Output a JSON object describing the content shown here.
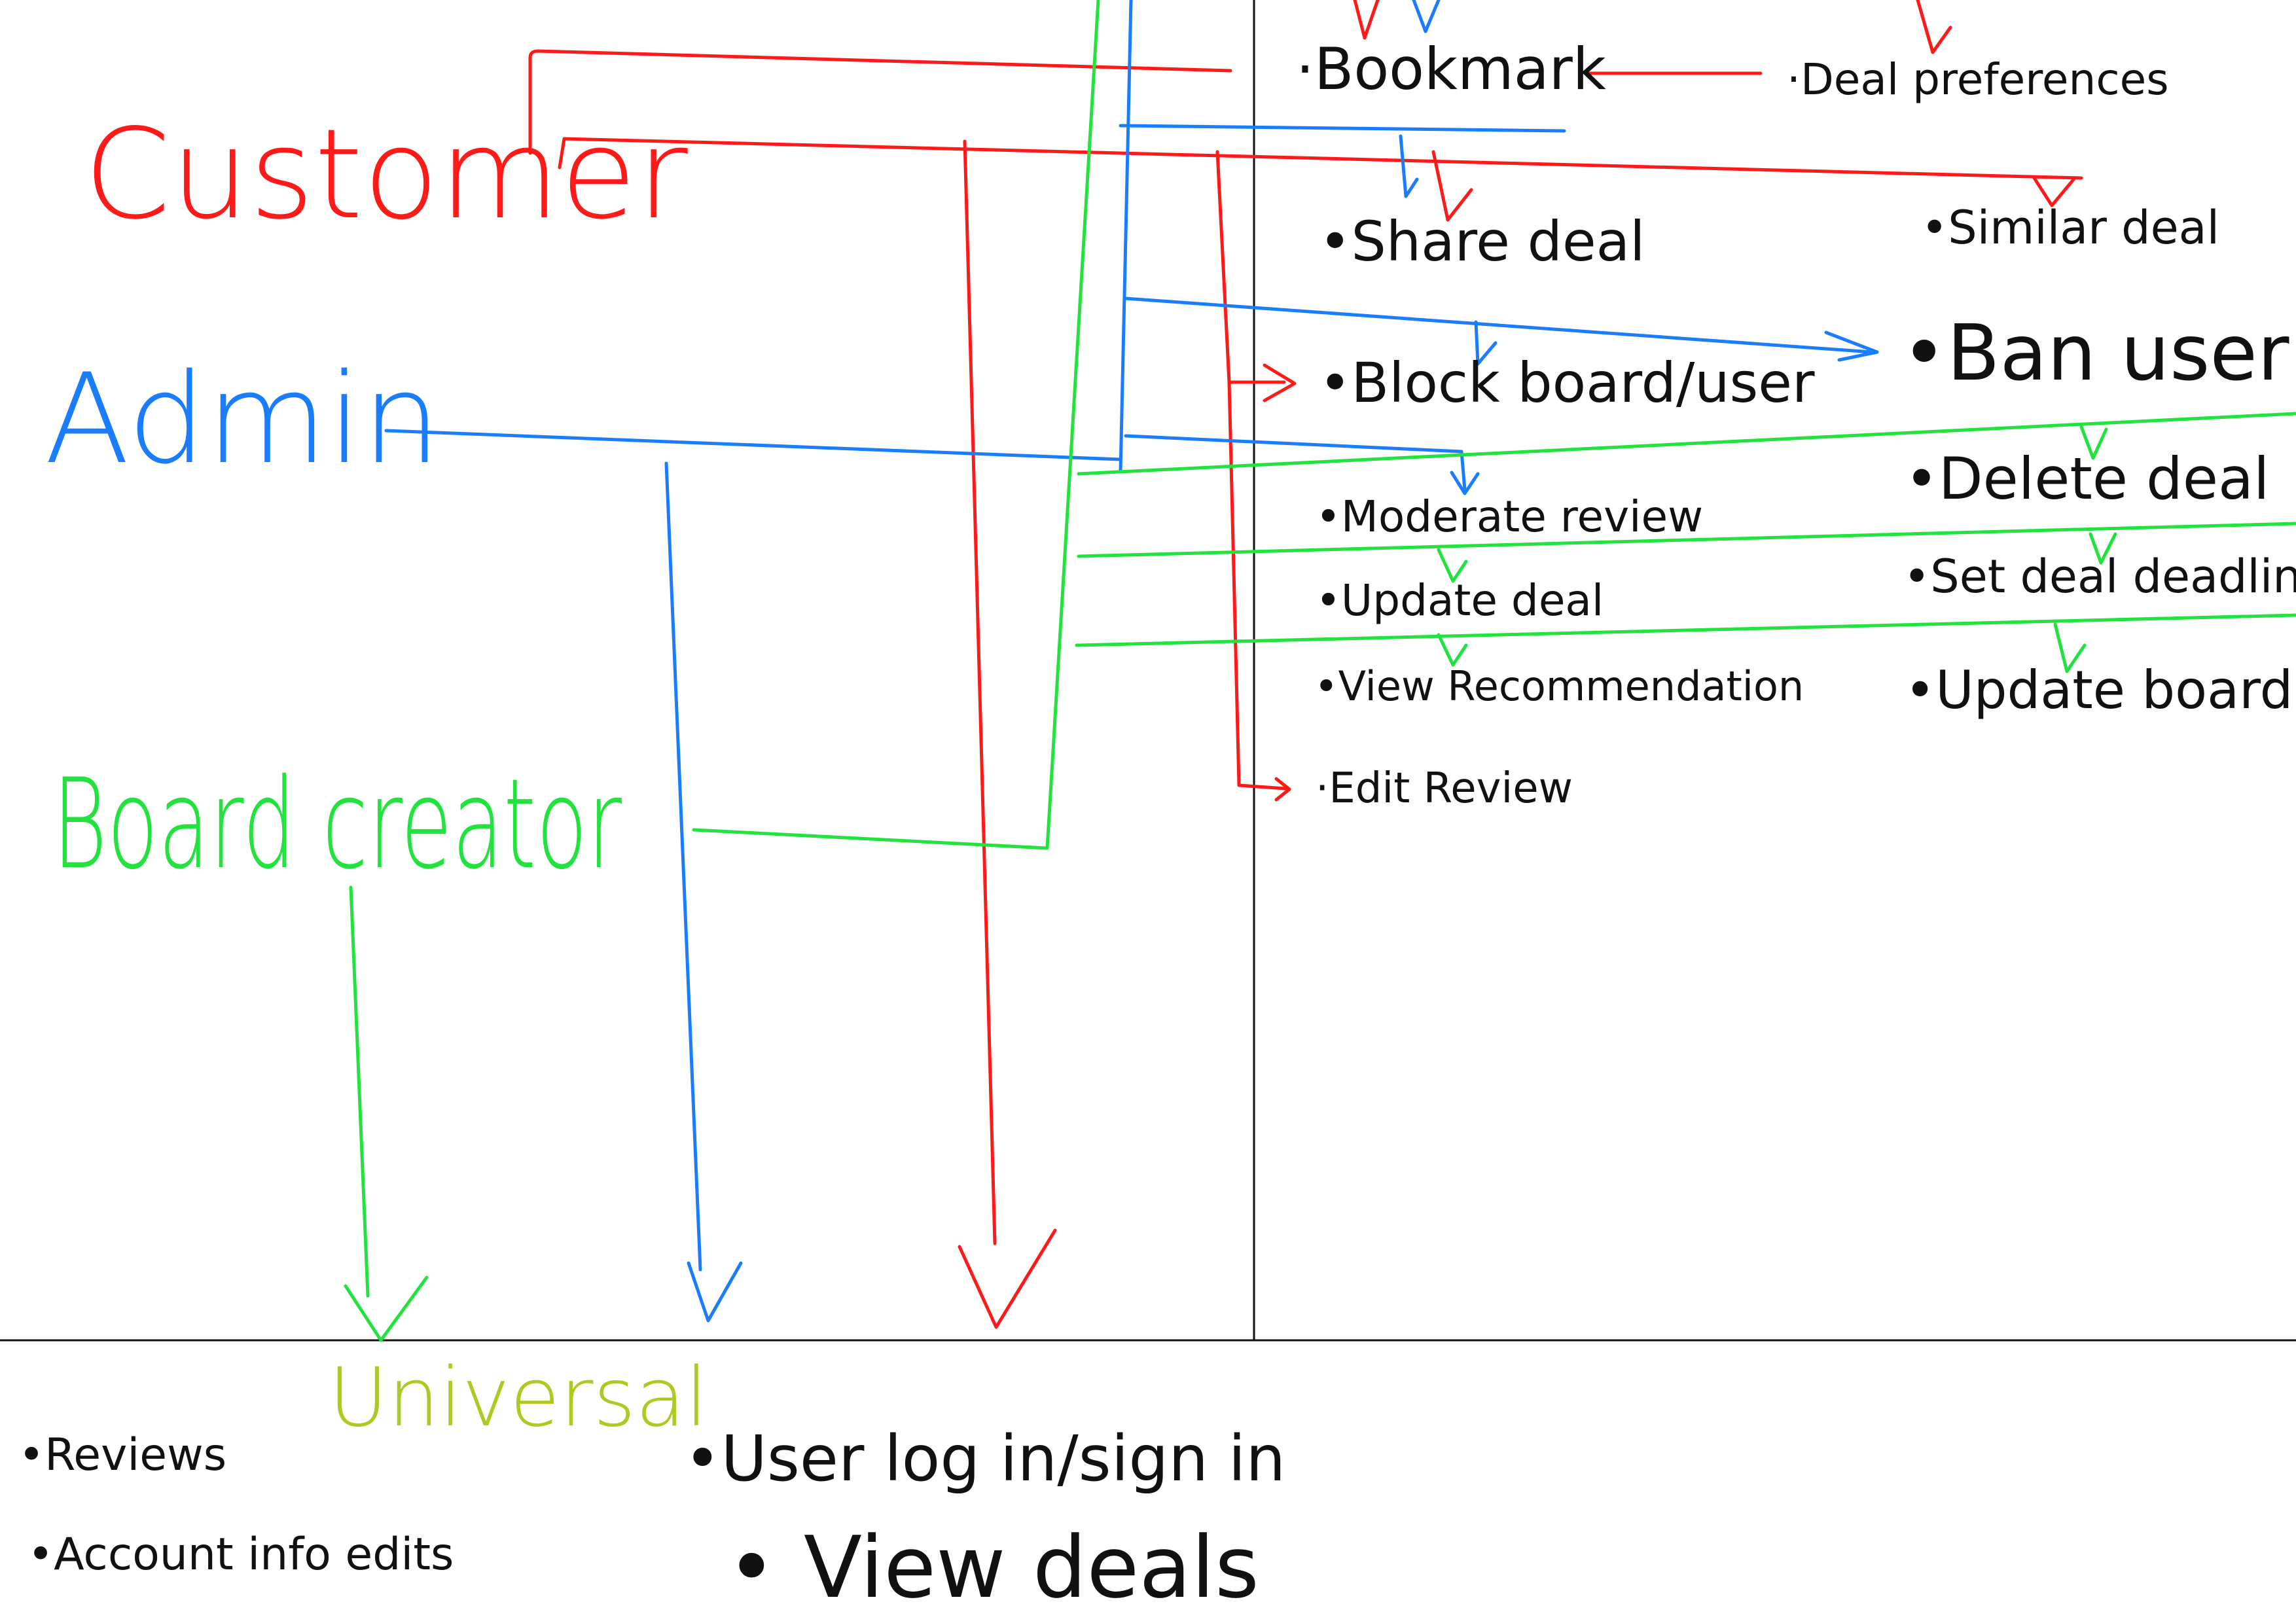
{
  "colors": {
    "customer": "#ff1a1a",
    "admin": "#1a7dff",
    "board_creator": "#22e33d",
    "universal": "#aacc22",
    "ink": "#111111"
  },
  "roles": {
    "customer": "Customer",
    "admin": "Admin",
    "board_creator": "Board creator"
  },
  "features": {
    "bookmark": "·Bookmark",
    "deal_preferences": "·Deal preferences",
    "share_deal": "•Share deal",
    "similar_deal": "•Similar deal",
    "block_board_user": "•Block board/user",
    "ban_user": "•Ban user",
    "moderate_review": "•Moderate review",
    "delete_deal": "•Delete deal",
    "update_deal": "•Update deal",
    "set_deal_deadline": "•Set deal deadline",
    "view_recommendation": "•View Recommendation",
    "update_board": "•Update board",
    "edit_review": "·Edit Review"
  },
  "universal": {
    "title": "Universal",
    "items": [
      "•Reviews",
      "•Account info edits",
      "•User log in/sign in",
      "• View deals"
    ]
  }
}
